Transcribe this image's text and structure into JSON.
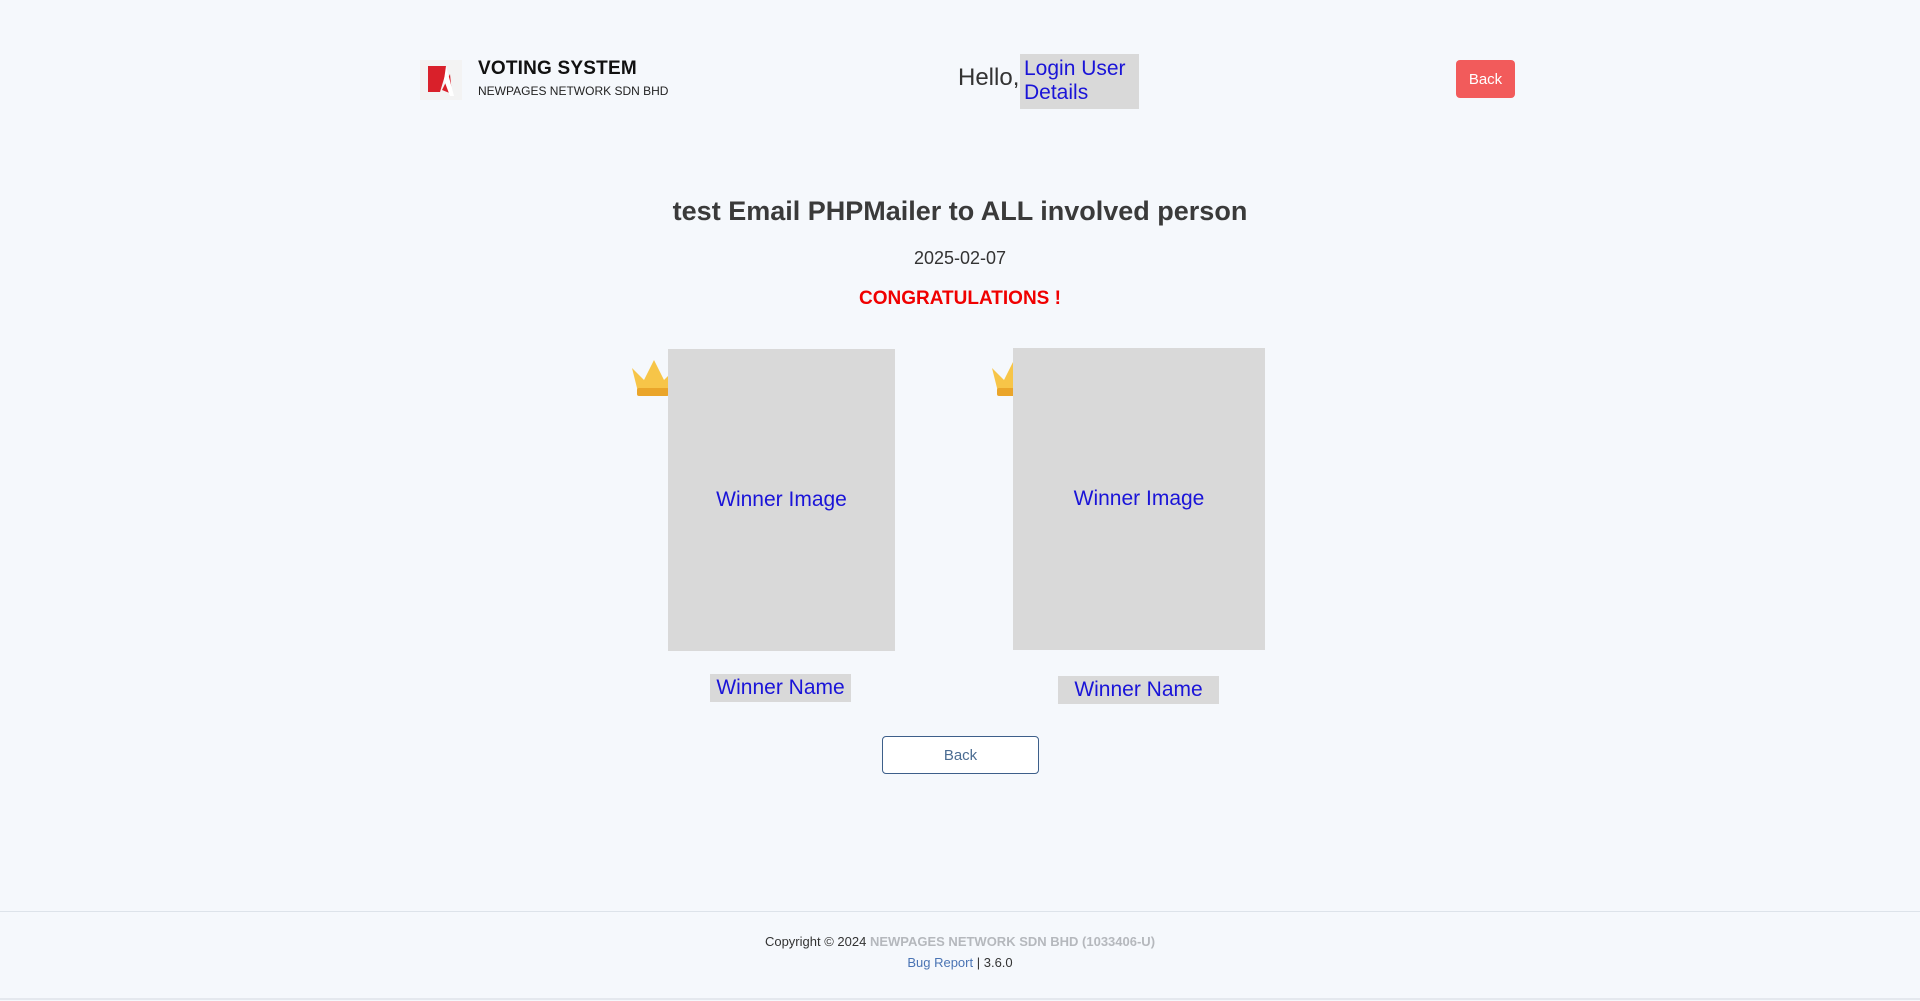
{
  "header": {
    "brand_title": "VOTING SYSTEM",
    "brand_subtitle": "NEWPAGES NETWORK SDN BHD",
    "greeting": "Hello,",
    "user_details": "Login User Details",
    "back_label": "Back"
  },
  "main": {
    "title": "test Email PHPMailer to ALL involved person",
    "date": "2025-02-07",
    "congrats": "CONGRATULATIONS !",
    "winners": [
      {
        "image_label": "Winner Image",
        "name": "Winner Name"
      },
      {
        "image_label": "Winner Image",
        "name": "Winner Name"
      }
    ],
    "back_label": "Back"
  },
  "footer": {
    "copyright": "Copyright © 2024",
    "company": "NEWPAGES NETWORK SDN BHD (1033406-U)",
    "bug_report": "Bug Report",
    "separator": "|",
    "version": "3.6.0"
  },
  "colors": {
    "background": "#f5f8fc",
    "accent_red": "#f25b5b",
    "congrats_red": "#f00000",
    "placeholder_gray": "#d9d9d9",
    "placeholder_text": "#1a14d8"
  },
  "icons": [
    "logo-icon",
    "crown-icon"
  ]
}
